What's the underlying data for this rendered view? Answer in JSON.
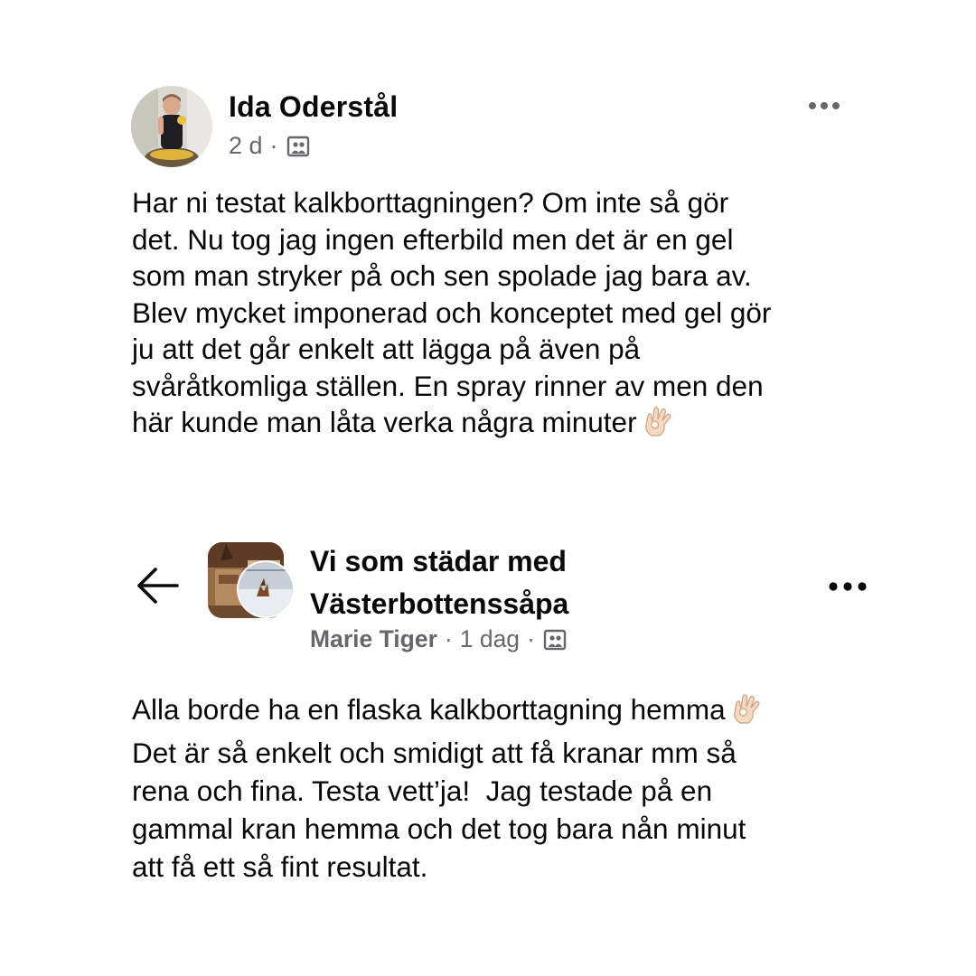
{
  "post1": {
    "author": "Ida Oderstål",
    "time": "2 d",
    "separator": "·",
    "privacy_icon": "group-members-icon",
    "more_icon": "more-options-icon",
    "body": "Har ni testat kalkborttagningen? Om inte så gör\ndet. Nu tog jag ingen efterbild men det är en gel\nsom man stryker på och sen spolade jag bara av.\nBlev mycket imponerad och konceptet med gel gör\nju att det går enkelt att lägga på även på\nsvåråtkomliga ställen. En spray rinner av men den\nhär kunde man låta verka några minuter",
    "emoji": "ok-hand-emoji"
  },
  "post2": {
    "back_icon": "back-arrow-icon",
    "group_name": "Vi som städar med Västerbottenssåpa",
    "author": "Marie Tiger",
    "time": "1 dag",
    "separator": "·",
    "privacy_icon": "group-members-icon",
    "more_icon": "more-options-icon",
    "body_line1": "Alla borde ha en flaska kalkborttagning hemma",
    "body_rest": "Det är så enkelt och smidigt att få kranar mm så\nrena och fina. Testa vett’ja!  Jag testade på en\ngammal kran hemma och det tog bara nån minut\natt få ett så fint resultat.",
    "emoji": "ok-hand-emoji"
  }
}
